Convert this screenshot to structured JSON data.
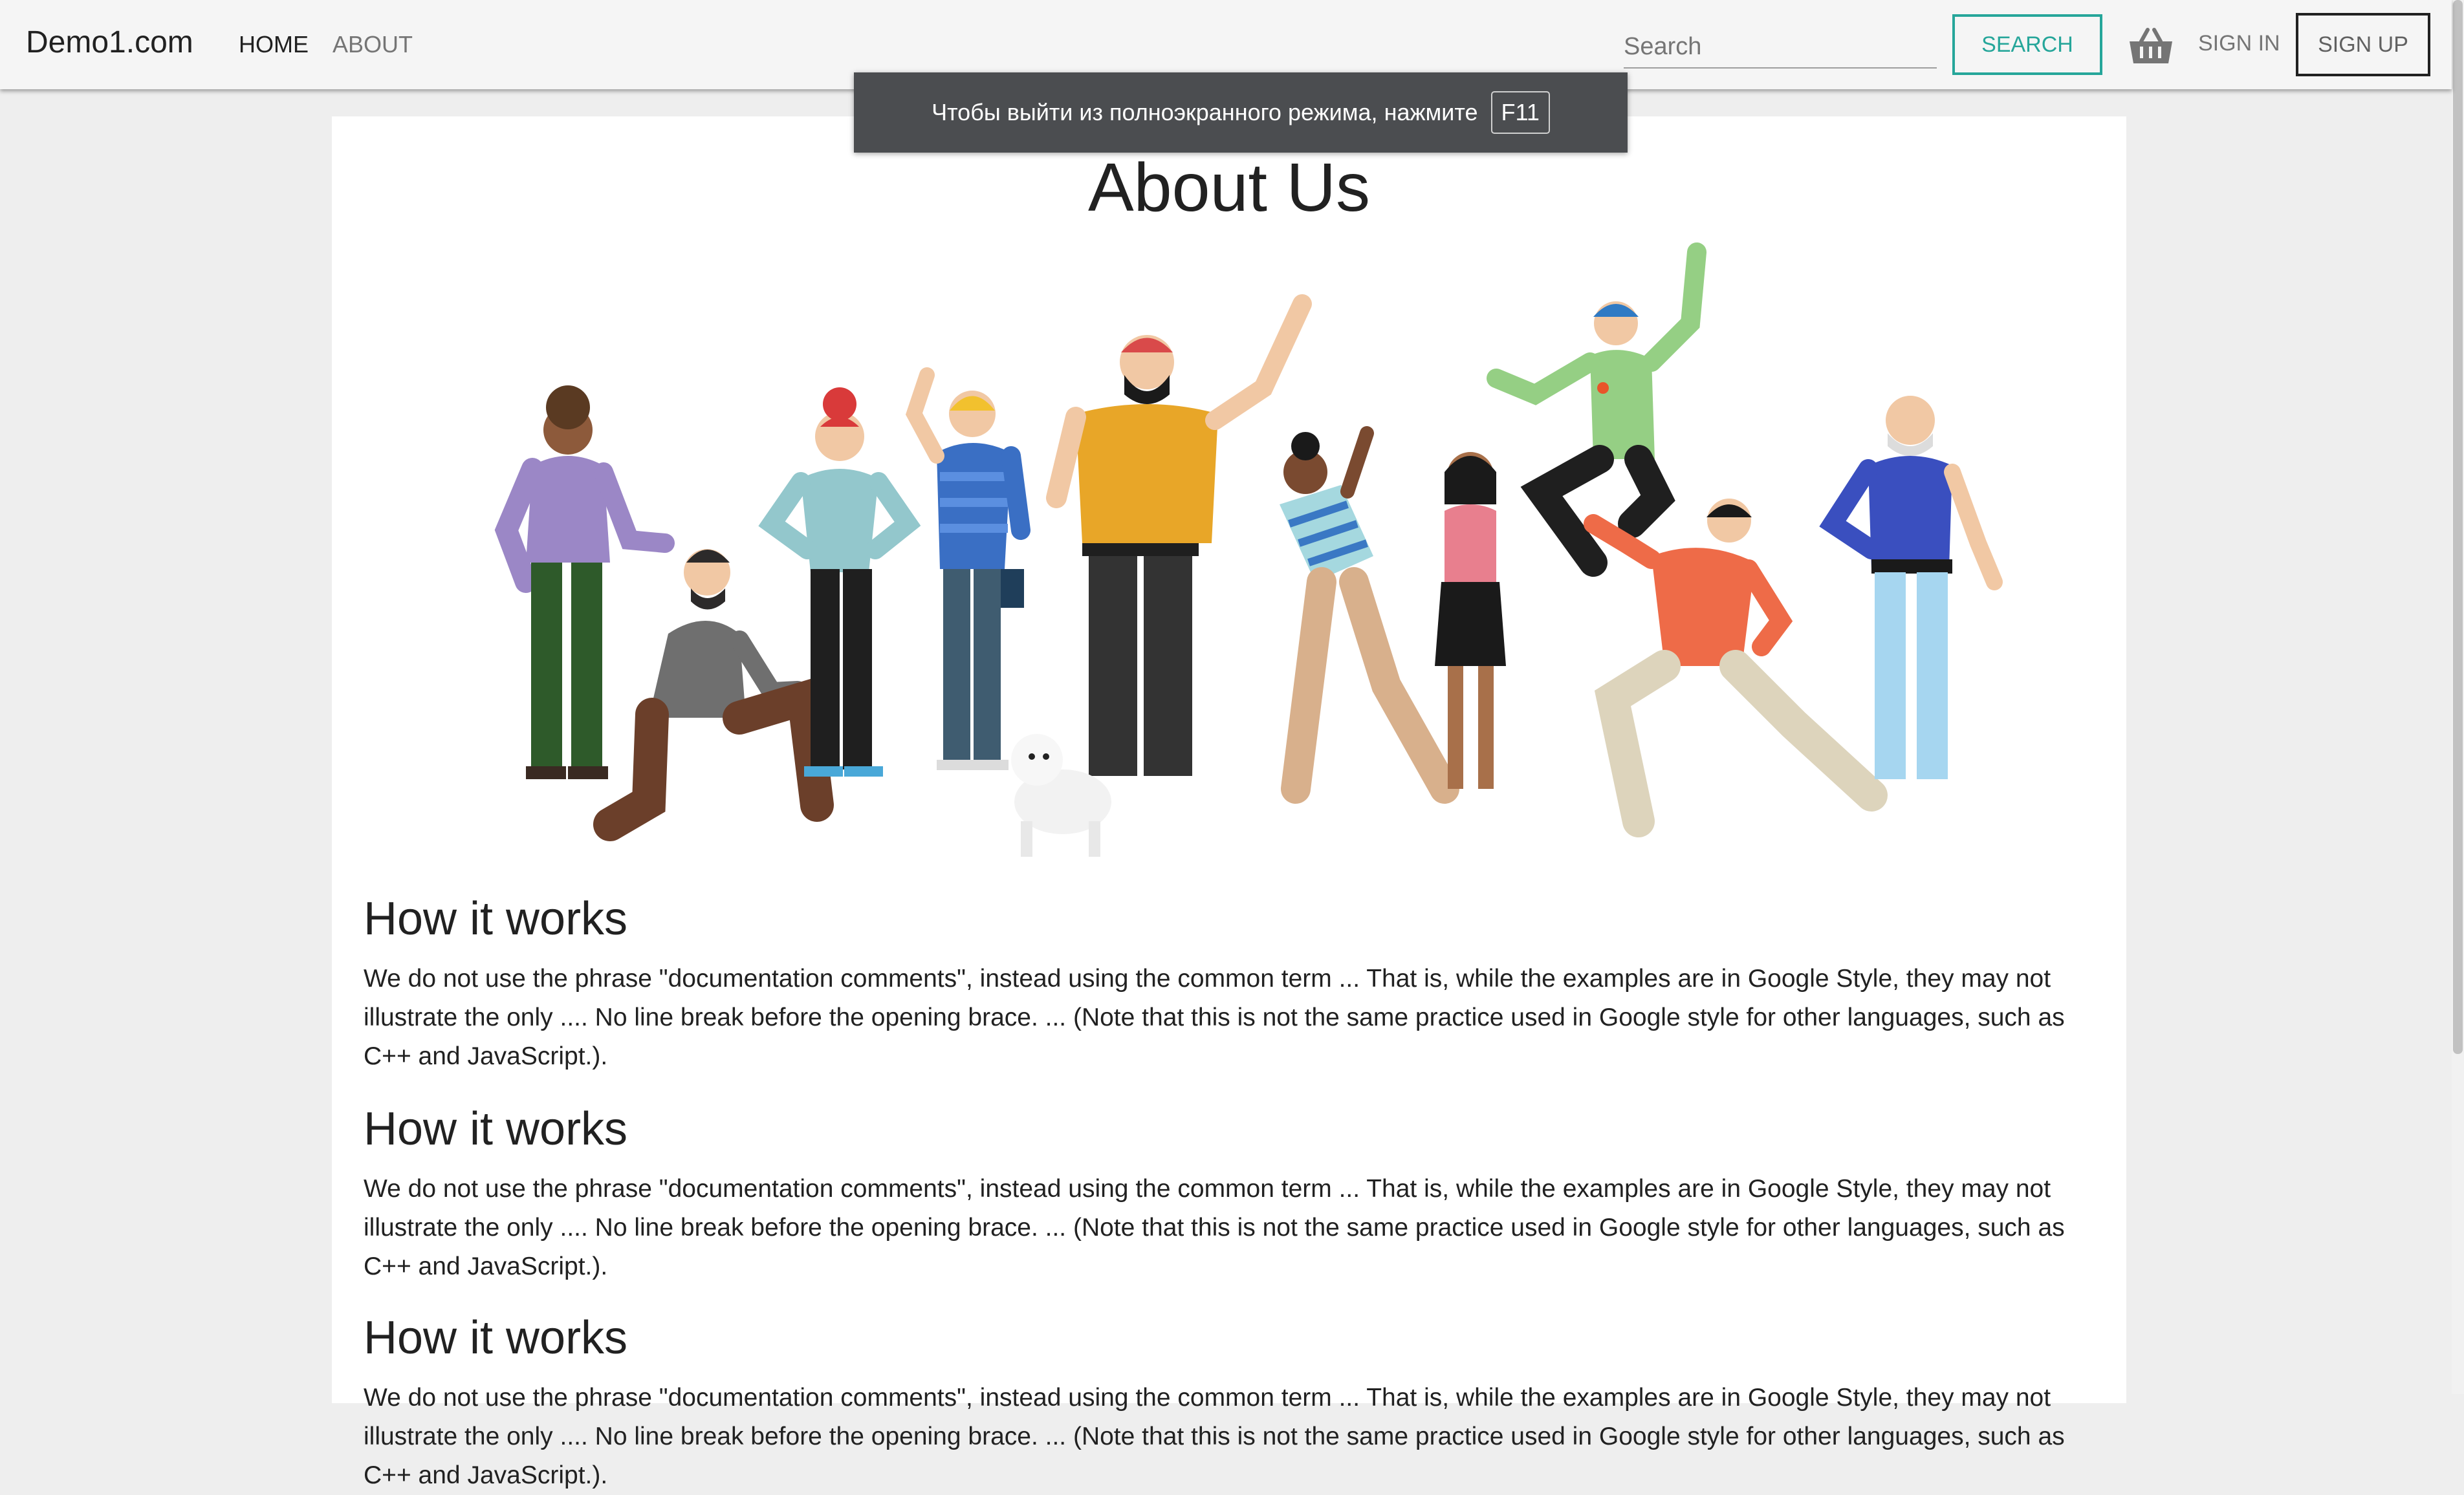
{
  "navbar": {
    "brand": "Demo1.com",
    "links": [
      {
        "label": "HOME"
      },
      {
        "label": "ABOUT"
      }
    ],
    "search_placeholder": "Search",
    "search_button": "SEARCH",
    "basket_icon": "shopping-basket-icon",
    "sign_in": "SIGN IN",
    "sign_up": "SIGN UP"
  },
  "toast": {
    "text": "Чтобы выйти из полноэкранного режима, нажмите",
    "key": "F11"
  },
  "main": {
    "title": "About Us",
    "illustration": "group-of-people-illustration",
    "sections": [
      {
        "heading": "How it works",
        "body": "We do not use the phrase \"documentation comments\", instead using the common term ... That is, while the examples are in Google Style, they may not illustrate the only .... No line break before the opening brace. ... (Note that this is not the same practice used in Google style for other languages, such as C++ and JavaScript.)."
      },
      {
        "heading": "How it works",
        "body": "We do not use the phrase \"documentation comments\", instead using the common term ... That is, while the examples are in Google Style, they may not illustrate the only .... No line break before the opening brace. ... (Note that this is not the same practice used in Google style for other languages, such as C++ and JavaScript.)."
      },
      {
        "heading": "How it works",
        "body": "We do not use the phrase \"documentation comments\", instead using the common term ... That is, while the examples are in Google Style, they may not illustrate the only .... No line break before the opening brace. ... (Note that this is not the same practice used in Google style for other languages, such as C++ and JavaScript.)."
      }
    ]
  },
  "colors": {
    "accent": "#26a69a",
    "navbar_bg": "#f5f5f5",
    "page_bg": "#eeeeee",
    "toast_bg": "#4b4d50"
  }
}
